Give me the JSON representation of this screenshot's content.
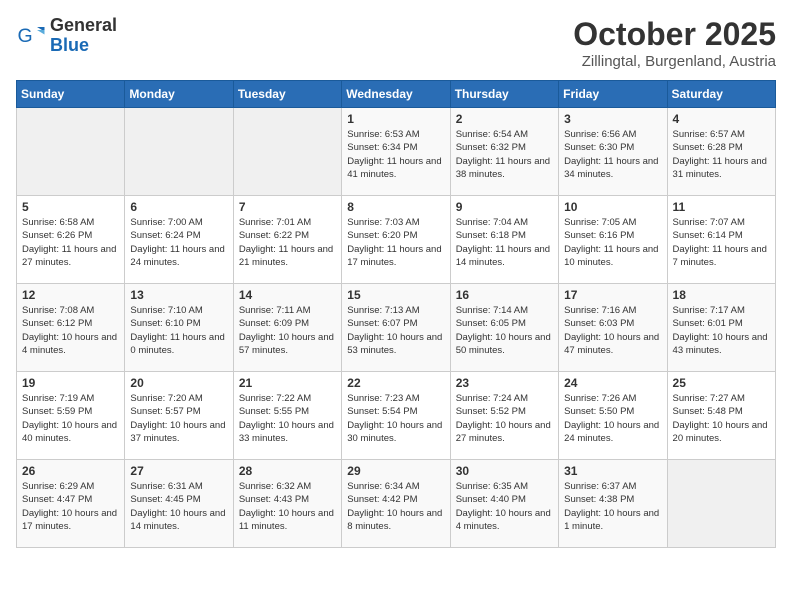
{
  "logo": {
    "general": "General",
    "blue": "Blue"
  },
  "header": {
    "month": "October 2025",
    "location": "Zillingtal, Burgenland, Austria"
  },
  "weekdays": [
    "Sunday",
    "Monday",
    "Tuesday",
    "Wednesday",
    "Thursday",
    "Friday",
    "Saturday"
  ],
  "weeks": [
    [
      {
        "day": "",
        "empty": true
      },
      {
        "day": "",
        "empty": true
      },
      {
        "day": "",
        "empty": true
      },
      {
        "day": "1",
        "sunrise": "6:53 AM",
        "sunset": "6:34 PM",
        "daylight": "11 hours and 41 minutes."
      },
      {
        "day": "2",
        "sunrise": "6:54 AM",
        "sunset": "6:32 PM",
        "daylight": "11 hours and 38 minutes."
      },
      {
        "day": "3",
        "sunrise": "6:56 AM",
        "sunset": "6:30 PM",
        "daylight": "11 hours and 34 minutes."
      },
      {
        "day": "4",
        "sunrise": "6:57 AM",
        "sunset": "6:28 PM",
        "daylight": "11 hours and 31 minutes."
      }
    ],
    [
      {
        "day": "5",
        "sunrise": "6:58 AM",
        "sunset": "6:26 PM",
        "daylight": "11 hours and 27 minutes."
      },
      {
        "day": "6",
        "sunrise": "7:00 AM",
        "sunset": "6:24 PM",
        "daylight": "11 hours and 24 minutes."
      },
      {
        "day": "7",
        "sunrise": "7:01 AM",
        "sunset": "6:22 PM",
        "daylight": "11 hours and 21 minutes."
      },
      {
        "day": "8",
        "sunrise": "7:03 AM",
        "sunset": "6:20 PM",
        "daylight": "11 hours and 17 minutes."
      },
      {
        "day": "9",
        "sunrise": "7:04 AM",
        "sunset": "6:18 PM",
        "daylight": "11 hours and 14 minutes."
      },
      {
        "day": "10",
        "sunrise": "7:05 AM",
        "sunset": "6:16 PM",
        "daylight": "11 hours and 10 minutes."
      },
      {
        "day": "11",
        "sunrise": "7:07 AM",
        "sunset": "6:14 PM",
        "daylight": "11 hours and 7 minutes."
      }
    ],
    [
      {
        "day": "12",
        "sunrise": "7:08 AM",
        "sunset": "6:12 PM",
        "daylight": "10 hours and 4 minutes."
      },
      {
        "day": "13",
        "sunrise": "7:10 AM",
        "sunset": "6:10 PM",
        "daylight": "11 hours and 0 minutes."
      },
      {
        "day": "14",
        "sunrise": "7:11 AM",
        "sunset": "6:09 PM",
        "daylight": "10 hours and 57 minutes."
      },
      {
        "day": "15",
        "sunrise": "7:13 AM",
        "sunset": "6:07 PM",
        "daylight": "10 hours and 53 minutes."
      },
      {
        "day": "16",
        "sunrise": "7:14 AM",
        "sunset": "6:05 PM",
        "daylight": "10 hours and 50 minutes."
      },
      {
        "day": "17",
        "sunrise": "7:16 AM",
        "sunset": "6:03 PM",
        "daylight": "10 hours and 47 minutes."
      },
      {
        "day": "18",
        "sunrise": "7:17 AM",
        "sunset": "6:01 PM",
        "daylight": "10 hours and 43 minutes."
      }
    ],
    [
      {
        "day": "19",
        "sunrise": "7:19 AM",
        "sunset": "5:59 PM",
        "daylight": "10 hours and 40 minutes."
      },
      {
        "day": "20",
        "sunrise": "7:20 AM",
        "sunset": "5:57 PM",
        "daylight": "10 hours and 37 minutes."
      },
      {
        "day": "21",
        "sunrise": "7:22 AM",
        "sunset": "5:55 PM",
        "daylight": "10 hours and 33 minutes."
      },
      {
        "day": "22",
        "sunrise": "7:23 AM",
        "sunset": "5:54 PM",
        "daylight": "10 hours and 30 minutes."
      },
      {
        "day": "23",
        "sunrise": "7:24 AM",
        "sunset": "5:52 PM",
        "daylight": "10 hours and 27 minutes."
      },
      {
        "day": "24",
        "sunrise": "7:26 AM",
        "sunset": "5:50 PM",
        "daylight": "10 hours and 24 minutes."
      },
      {
        "day": "25",
        "sunrise": "7:27 AM",
        "sunset": "5:48 PM",
        "daylight": "10 hours and 20 minutes."
      }
    ],
    [
      {
        "day": "26",
        "sunrise": "6:29 AM",
        "sunset": "4:47 PM",
        "daylight": "10 hours and 17 minutes."
      },
      {
        "day": "27",
        "sunrise": "6:31 AM",
        "sunset": "4:45 PM",
        "daylight": "10 hours and 14 minutes."
      },
      {
        "day": "28",
        "sunrise": "6:32 AM",
        "sunset": "4:43 PM",
        "daylight": "10 hours and 11 minutes."
      },
      {
        "day": "29",
        "sunrise": "6:34 AM",
        "sunset": "4:42 PM",
        "daylight": "10 hours and 8 minutes."
      },
      {
        "day": "30",
        "sunrise": "6:35 AM",
        "sunset": "4:40 PM",
        "daylight": "10 hours and 4 minutes."
      },
      {
        "day": "31",
        "sunrise": "6:37 AM",
        "sunset": "4:38 PM",
        "daylight": "10 hours and 1 minute."
      },
      {
        "day": "",
        "empty": true
      }
    ]
  ]
}
